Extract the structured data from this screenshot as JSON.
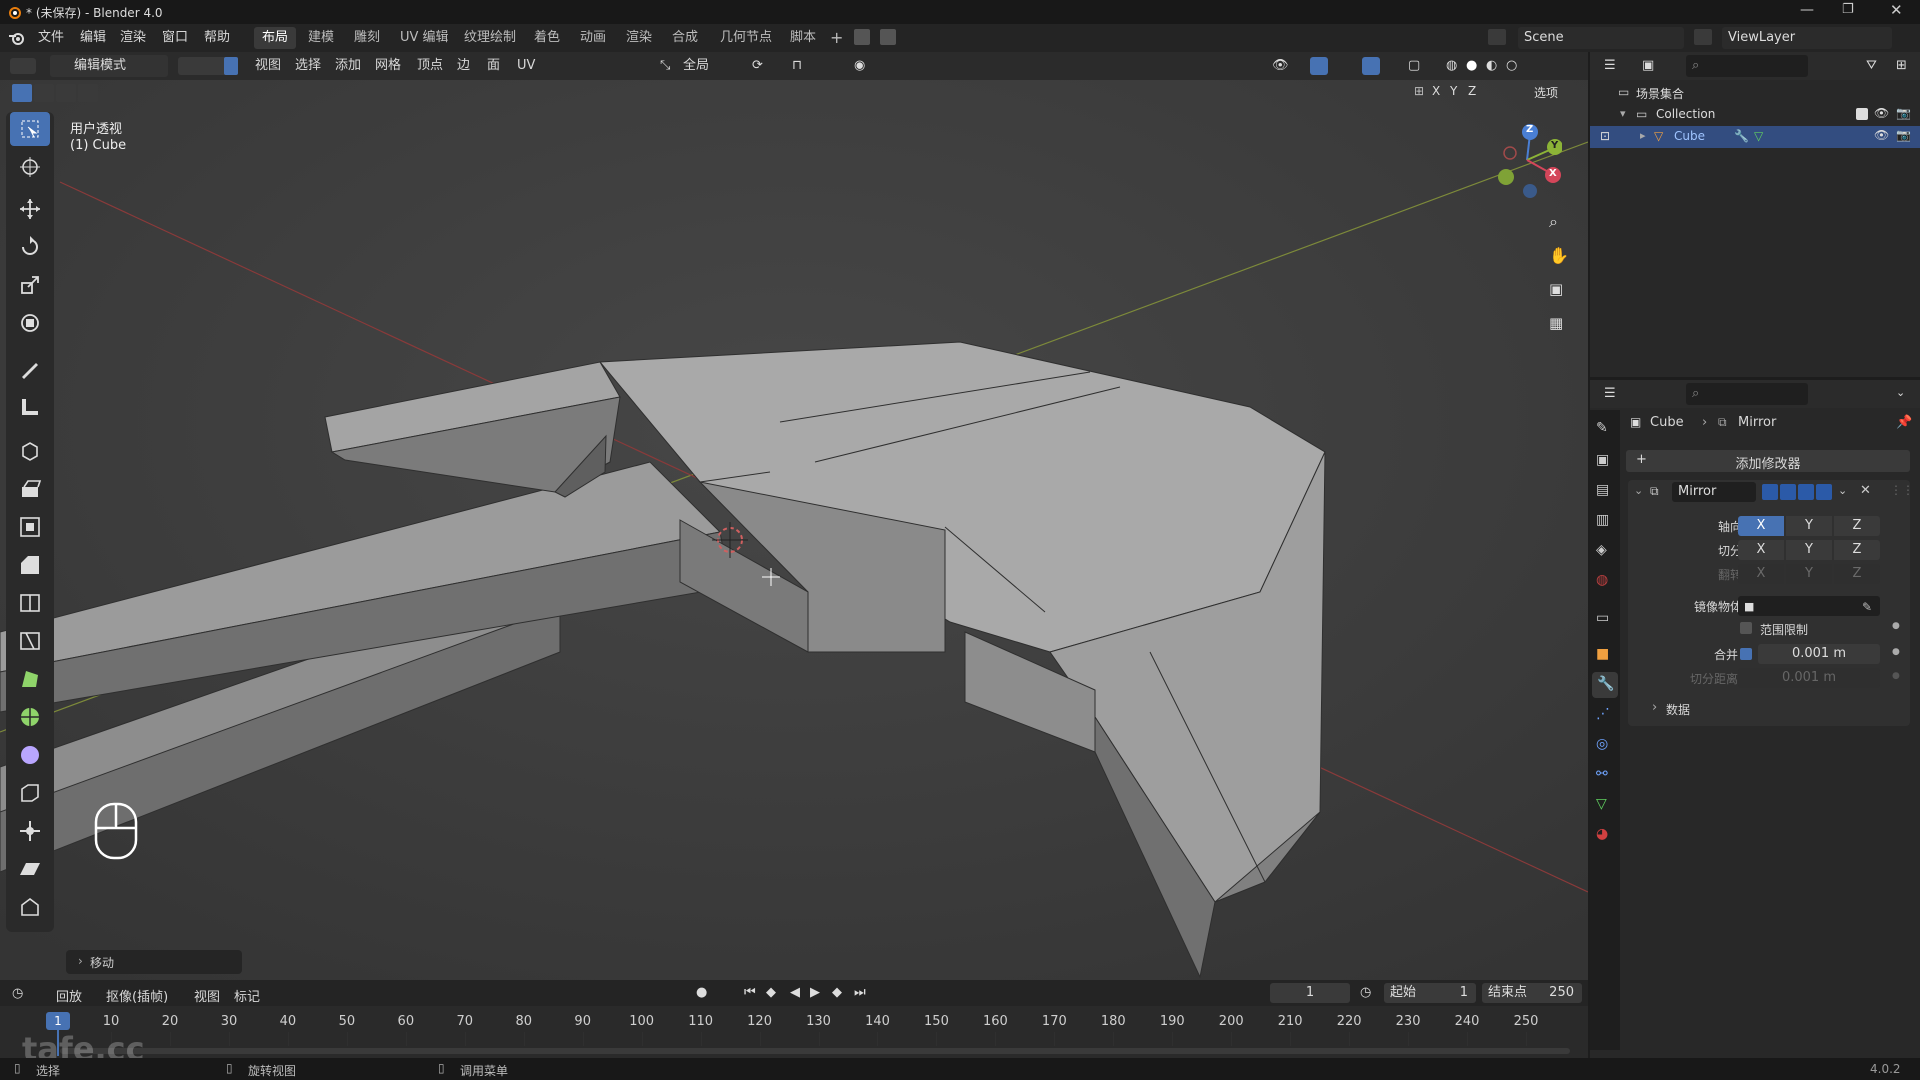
{
  "window": {
    "title": "* (未保存) - Blender 4.0"
  },
  "menus": [
    "文件",
    "编辑",
    "渲染",
    "窗口",
    "帮助"
  ],
  "workspaces": [
    {
      "label": "布局",
      "active": true
    },
    {
      "label": "建模"
    },
    {
      "label": "雕刻"
    },
    {
      "label": "UV 编辑"
    },
    {
      "label": "纹理绘制"
    },
    {
      "label": "着色"
    },
    {
      "label": "动画"
    },
    {
      "label": "渲染"
    },
    {
      "label": "合成"
    },
    {
      "label": "几何节点"
    },
    {
      "label": "脚本"
    }
  ],
  "scene": {
    "name": "Scene",
    "view_layer": "ViewLayer"
  },
  "viewport_header": {
    "mode": "编辑模式",
    "menus": [
      "视图",
      "选择",
      "添加",
      "网格",
      "顶点",
      "边",
      "面",
      "UV"
    ],
    "transform_orientation": "全局",
    "options": "选项",
    "axes": [
      "X",
      "Y",
      "Z"
    ]
  },
  "viewport": {
    "view_name": "用户透视",
    "object_label": "(1) Cube",
    "last_op": "移动"
  },
  "gizmo": {
    "x": "X",
    "y": "Y",
    "z": "Z"
  },
  "outliner": {
    "root": "场景集合",
    "collection": "Collection",
    "object": "Cube"
  },
  "properties": {
    "breadcrumb_object": "Cube",
    "breadcrumb_modifier": "Mirror",
    "add_modifier": "添加修改器",
    "modifier_name": "Mirror",
    "axis_label": "轴向",
    "bisect_label": "切分",
    "flip_label": "翻转",
    "axis_buttons": [
      "X",
      "Y",
      "Z"
    ],
    "mirror_object_label": "镜像物体",
    "clipping_label": "范围限制",
    "merge_label": "合并",
    "merge_value": "0.001 m",
    "bisect_distance_label": "切分距离",
    "bisect_distance_value": "0.001 m",
    "data_label": "数据"
  },
  "timeline": {
    "menus": [
      "回放",
      "抠像(插帧)",
      "视图",
      "标记"
    ],
    "current_frame": "1",
    "start_label": "起始",
    "start_value": "1",
    "end_label": "结束点",
    "end_value": "250",
    "frame_marks": [
      "1",
      "10",
      "20",
      "30",
      "40",
      "50",
      "60",
      "70",
      "80",
      "90",
      "100",
      "110",
      "120",
      "130",
      "140",
      "150",
      "160",
      "170",
      "180",
      "190",
      "200",
      "210",
      "220",
      "230",
      "240",
      "250"
    ]
  },
  "statusbar": {
    "select": "选择",
    "rotate": "旋转视图",
    "context_menu": "调用菜单",
    "version": "4.0.2"
  },
  "watermark": "tafe.cc"
}
